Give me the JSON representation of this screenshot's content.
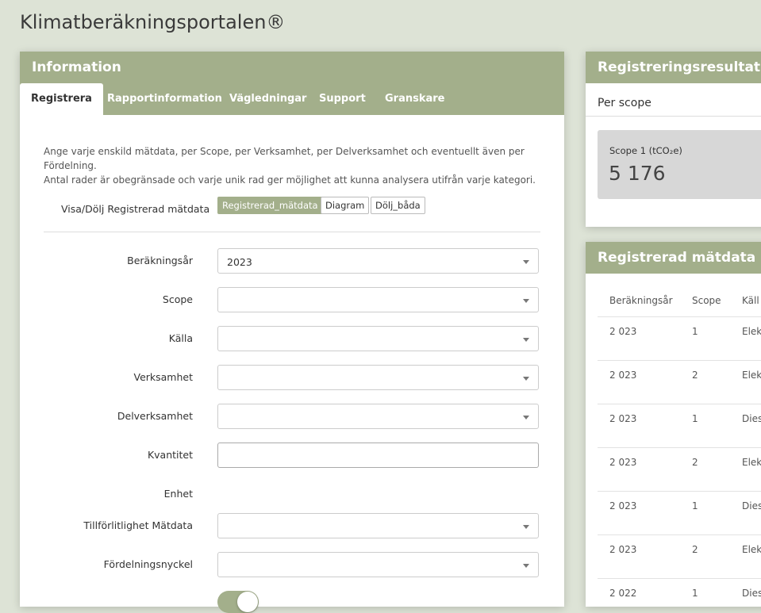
{
  "app": {
    "title": "Klimatberäkningsportalen®"
  },
  "info_panel": {
    "title": "Information",
    "tabs": [
      "Registrera",
      "Rapportinformation",
      "Vägledningar",
      "Support",
      "Granskare"
    ],
    "intro_line1": "Ange varje enskild mätdata, per Scope, per Verksamhet, per Delverksamhet och eventuellt även per Fördelning.",
    "intro_line2": "Antal rader är obegränsade och varje unik rad ger möjlighet att kunna analysera utifrån varje kategori.",
    "toggle_label": "Visa/Dölj Registrerad mätdata",
    "toggle_options": [
      "Registrerad_mätdata",
      "Diagram",
      "Dölj_båda"
    ],
    "toggle_selected": "Registrerad_mätdata",
    "form": {
      "year_label": "Beräkningsår",
      "year_value": "2023",
      "scope_label": "Scope",
      "scope_value": "",
      "source_label": "Källa",
      "source_value": "",
      "business_label": "Verksamhet",
      "business_value": "",
      "subbusiness_label": "Delverksamhet",
      "subbusiness_value": "",
      "quantity_label": "Kvantitet",
      "quantity_value": "",
      "unit_label": "Enhet",
      "reliability_label": "Tillförlitlighet Mätdata",
      "reliability_value": "",
      "distribution_label": "Fördelningsnyckel",
      "distribution_value": ""
    }
  },
  "result_panel": {
    "title": "Registreringsresultat",
    "per_scope": "Per scope",
    "scope1_label": "Scope 1 (tCO₂e)",
    "scope1_value": "5 176"
  },
  "measure_panel": {
    "title": "Registrerad mätdata",
    "columns": [
      "Beräkningsår",
      "Scope",
      "Käll"
    ],
    "rows": [
      [
        "2 023",
        "1",
        "Elek"
      ],
      [
        "2 023",
        "2",
        "Elek"
      ],
      [
        "2 023",
        "1",
        "Dies"
      ],
      [
        "2 023",
        "2",
        "Elek"
      ],
      [
        "2 023",
        "1",
        "Dies"
      ],
      [
        "2 023",
        "2",
        "Elek"
      ],
      [
        "2 022",
        "1",
        "Dies"
      ]
    ]
  },
  "colors": {
    "accent": "#a3af8b",
    "background": "#dde3d6",
    "card": "#d7d7d7"
  }
}
